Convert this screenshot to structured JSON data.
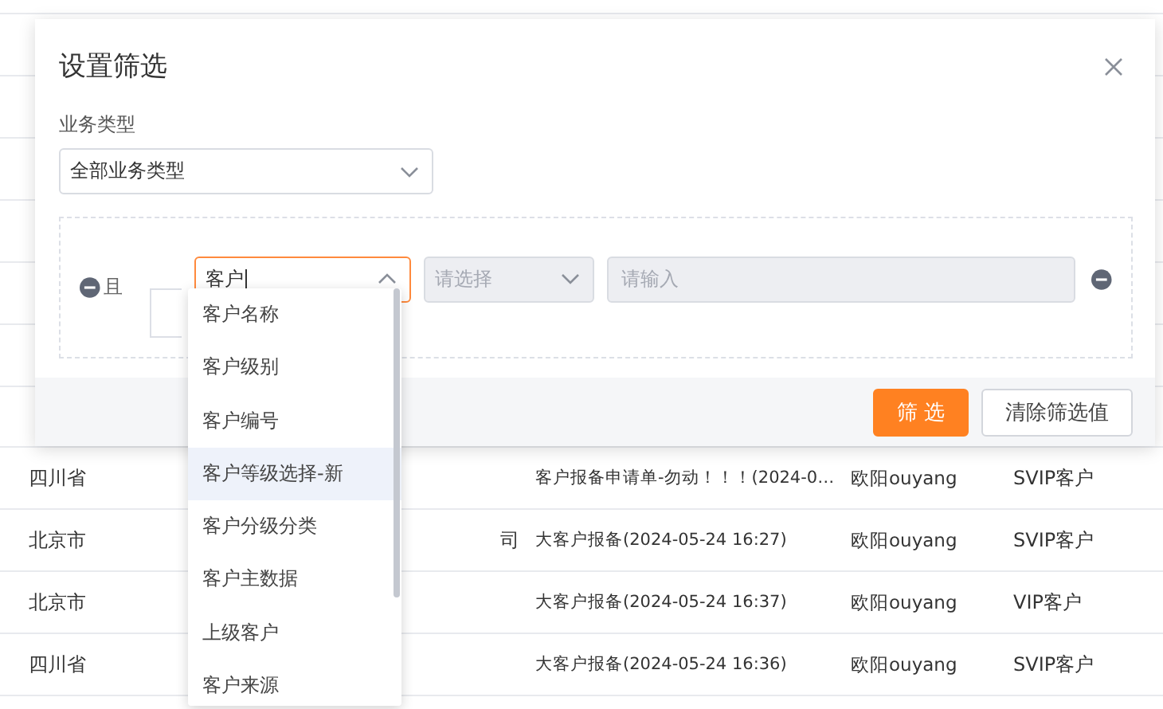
{
  "table": {
    "rows": [
      {
        "column_1": "四川省",
        "column_2": "",
        "column_3": "客户报备申请单-勿动！！！(2024-0…",
        "column_4": "欧阳ouyang",
        "column_5": "SVIP客户"
      },
      {
        "column_1": "北京市",
        "column_2": "司",
        "column_3": "大客户报备(2024-05-24 16:27)",
        "column_4": "欧阳ouyang",
        "column_5": "SVIP客户"
      },
      {
        "column_1": "北京市",
        "column_2": "",
        "column_3": "大客户报备(2024-05-24 16:37)",
        "column_4": "欧阳ouyang",
        "column_5": "VIP客户"
      },
      {
        "column_1": "四川省",
        "column_2": "",
        "column_3": "大客户报备(2024-05-24 16:36)",
        "column_4": "欧阳ouyang",
        "column_5": "SVIP客户"
      }
    ]
  },
  "dialog": {
    "title": "设置筛选",
    "business_type": {
      "label": "业务类型",
      "value": "全部业务类型"
    },
    "condition": {
      "logic": "且",
      "field": {
        "value": "客户",
        "expanded": true,
        "options": [
          {
            "label": "客户名称",
            "highlighted": false
          },
          {
            "label": "客户级别",
            "highlighted": false
          },
          {
            "label": "客户编号",
            "highlighted": false
          },
          {
            "label": "客户等级选择-新",
            "highlighted": true
          },
          {
            "label": "客户分级分类",
            "highlighted": false
          },
          {
            "label": "客户主数据",
            "highlighted": false
          },
          {
            "label": "上级客户",
            "highlighted": false
          },
          {
            "label": "客户来源",
            "highlighted": false
          }
        ]
      },
      "operator": {
        "placeholder": "请选择",
        "disabled": true
      },
      "value": {
        "placeholder": "请输入",
        "disabled": true
      }
    },
    "buttons": [
      {
        "label": "筛 选",
        "kind": "primary"
      },
      {
        "label": "清除筛选值",
        "kind": "default"
      }
    ]
  }
}
